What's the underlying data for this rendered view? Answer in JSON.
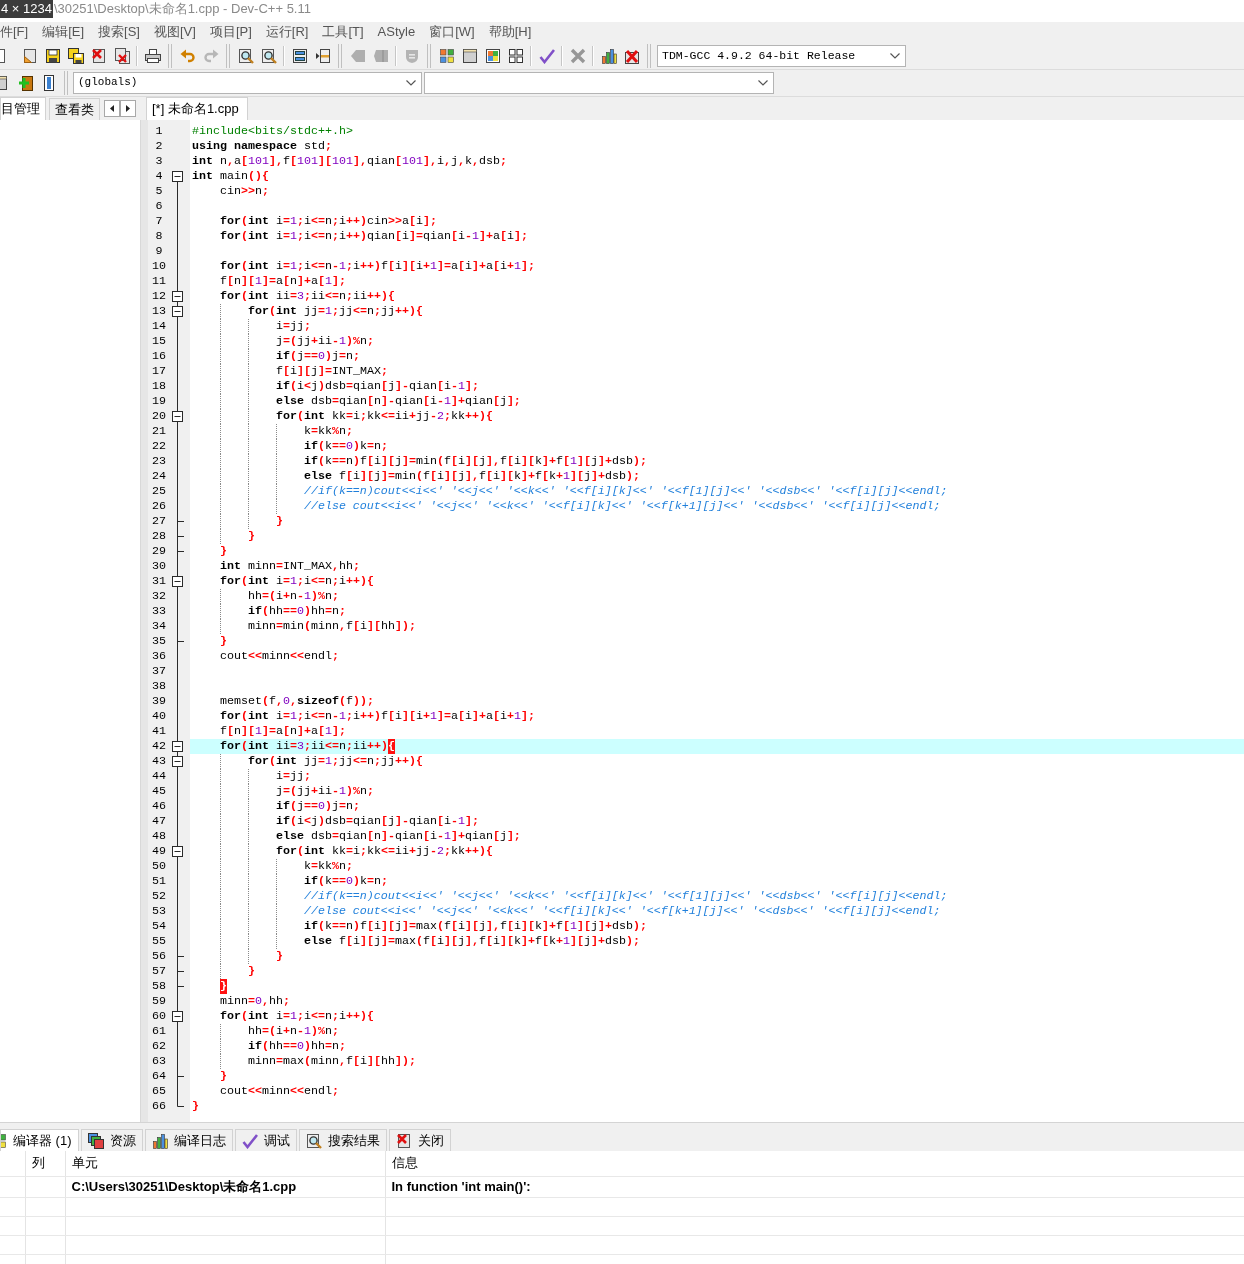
{
  "capture_overlay": "4 × 1234",
  "window": {
    "title": "\\30251\\Desktop\\未命名1.cpp - Dev-C++ 5.11"
  },
  "menu": [
    {
      "label": "件[F]"
    },
    {
      "label": "编辑[E]"
    },
    {
      "label": "搜索[S]"
    },
    {
      "label": "视图[V]"
    },
    {
      "label": "项目[P]"
    },
    {
      "label": "运行[R]"
    },
    {
      "label": "工具[T]"
    },
    {
      "label": "AStyle"
    },
    {
      "label": "窗口[W]"
    },
    {
      "label": "帮助[H]"
    }
  ],
  "toolbar_main": [
    {
      "disabled": false
    },
    {
      "disabled": false
    },
    {
      "disabled": false
    },
    {
      "disabled": false
    },
    {
      "disabled": false
    },
    {
      "disabled": false
    },
    {
      "disabled": false
    },
    {
      "disabled": false
    },
    {
      "disabled": true
    },
    {
      "disabled": false
    },
    {
      "disabled": false
    },
    {
      "disabled": false
    },
    {
      "disabled": false
    },
    {
      "disabled": true
    },
    {
      "disabled": true
    },
    {
      "disabled": true
    },
    {
      "disabled": false
    },
    {
      "disabled": false
    },
    {
      "disabled": false
    },
    {
      "disabled": false
    },
    {
      "disabled": false
    },
    {
      "disabled": true
    },
    {
      "disabled": false
    },
    {
      "disabled": false
    }
  ],
  "compiler_select": {
    "value": "TDM-GCC 4.9.2 64-bit Release"
  },
  "toolbar_secondary": [
    {
      "disabled": false
    },
    {
      "disabled": false
    },
    {
      "disabled": false
    }
  ],
  "class_select": {
    "value": "(globals)"
  },
  "left_panel": {
    "tabs": [
      {
        "label": "目管理",
        "selected": true
      },
      {
        "label": "查看类",
        "selected": false
      }
    ]
  },
  "editor": {
    "tabs": [
      {
        "label": "[*] 未命名1.cpp",
        "selected": true
      }
    ],
    "lines": [
      {
        "number": "1",
        "kind": "preprocessor",
        "text": "#include<bits/stdc++.h>",
        "current": false
      },
      {
        "number": "2",
        "kind": "code",
        "text": "**using namespace** std;",
        "current": false
      },
      {
        "number": "3",
        "kind": "code",
        "text": "**int** n,a[101],f[101][101],qian[101],i,j,k,dsb;",
        "current": false
      },
      {
        "number": "4",
        "kind": "code",
        "text": "**int** main(){",
        "expanded": true,
        "current": false
      },
      {
        "number": "5",
        "kind": "code",
        "text": "    cin>>n;",
        "current": false
      },
      {
        "number": "6",
        "current": false
      },
      {
        "number": "7",
        "kind": "code",
        "text": "    **for**(**int** i=1;i<=n;i++)cin>>a[i];",
        "current": false
      },
      {
        "number": "8",
        "kind": "code",
        "text": "    **for**(**int** i=1;i<=n;i++)qian[i]=qian[i-1]+a[i];",
        "current": false
      },
      {
        "number": "9",
        "current": false
      },
      {
        "number": "10",
        "kind": "code",
        "text": "    **for**(**int** i=1;i<=n-1;i++)f[i][i+1]=a[i]+a[i+1];",
        "current": false
      },
      {
        "number": "11",
        "kind": "code",
        "text": "    f[n][1]=a[n]+a[1];",
        "current": false
      },
      {
        "number": "12",
        "kind": "code",
        "text": "    **for**(**int** ii=3;ii<=n;ii++){",
        "expanded": true,
        "current": false
      },
      {
        "number": "13",
        "kind": "code",
        "text": "        **for**(**int** jj=1;jj<=n;jj++){",
        "expanded": true,
        "current": false
      },
      {
        "number": "14",
        "kind": "code",
        "text": "            i=jj;",
        "current": false
      },
      {
        "number": "15",
        "kind": "code",
        "text": "            j=(jj+ii-1)%n;",
        "current": false
      },
      {
        "number": "16",
        "kind": "code",
        "text": "            **if**(j==0)j=n;",
        "current": false
      },
      {
        "number": "17",
        "kind": "code",
        "text": "            f[i][j]=INT_MAX;",
        "current": false
      },
      {
        "number": "18",
        "kind": "code",
        "text": "            **if**(i<j)dsb=qian[j]-qian[i-1];",
        "current": false
      },
      {
        "number": "19",
        "kind": "code",
        "text": "            **else** dsb=qian[n]-qian[i-1]+qian[j];",
        "current": false
      },
      {
        "number": "20",
        "kind": "code",
        "text": "            **for**(**int** kk=i;kk<=ii+jj-2;kk++){",
        "expanded": true,
        "current": false
      },
      {
        "number": "21",
        "kind": "code",
        "text": "                k=kk%n;",
        "current": false
      },
      {
        "number": "22",
        "kind": "code",
        "text": "                **if**(k==0)k=n;",
        "current": false
      },
      {
        "number": "23",
        "kind": "code",
        "text": "                **if**(k==n)f[i][j]=min(f[i][j],f[i][k]+f[1][j]+dsb);",
        "current": false
      },
      {
        "number": "24",
        "kind": "code",
        "text": "                **else** f[i][j]=min(f[i][j],f[i][k]+f[k+1][j]+dsb);",
        "current": false
      },
      {
        "number": "25",
        "kind": "comment",
        "text": "                //if(k==n)cout<<i<<' '<<j<<' '<<k<<' '<<f[i][k]<<' '<<f[1][j]<<' '<<dsb<<' '<<f[i][j]<<endl;",
        "current": false
      },
      {
        "number": "26",
        "kind": "comment",
        "text": "                //else cout<<i<<' '<<j<<' '<<k<<' '<<f[i][k]<<' '<<f[k+1][j]<<' '<<dsb<<' '<<f[i][j]<<endl;",
        "current": false
      },
      {
        "number": "27",
        "kind": "code",
        "text": "            }",
        "fold_end": true,
        "current": false
      },
      {
        "number": "28",
        "kind": "code",
        "text": "        }",
        "fold_end": true,
        "current": false
      },
      {
        "number": "29",
        "kind": "code",
        "text": "    }",
        "fold_end": true,
        "current": false
      },
      {
        "number": "30",
        "kind": "code",
        "text": "    **int** minn=INT_MAX,hh;",
        "current": false
      },
      {
        "number": "31",
        "kind": "code",
        "text": "    **for**(**int** i=1;i<=n;i++){",
        "expanded": true,
        "current": false
      },
      {
        "number": "32",
        "kind": "code",
        "text": "        hh=(i+n-1)%n;",
        "current": false
      },
      {
        "number": "33",
        "kind": "code",
        "text": "        **if**(hh==0)hh=n;",
        "current": false
      },
      {
        "number": "34",
        "kind": "code",
        "text": "        minn=min(minn,f[i][hh]);",
        "current": false
      },
      {
        "number": "35",
        "kind": "code",
        "text": "    }",
        "fold_end": true,
        "current": false
      },
      {
        "number": "36",
        "kind": "code",
        "text": "    cout<<minn<<endl;",
        "current": false
      },
      {
        "number": "37",
        "current": false
      },
      {
        "number": "38",
        "current": false
      },
      {
        "number": "39",
        "kind": "code",
        "text": "    memset(f,0,**sizeof**(f));",
        "current": false
      },
      {
        "number": "40",
        "kind": "code",
        "text": "    **for**(**int** i=1;i<=n-1;i++)f[i][i+1]=a[i]+a[i+1];",
        "current": false
      },
      {
        "number": "41",
        "kind": "code",
        "text": "    f[n][1]=a[n]+a[1];",
        "current": false
      },
      {
        "number": "42",
        "kind": "code",
        "text": "    **for**(**int** ii=3;ii<=n;ii++)",
        "brace": "{",
        "expanded": true,
        "current": true
      },
      {
        "number": "43",
        "kind": "code",
        "text": "        **for**(**int** jj=1;jj<=n;jj++){",
        "expanded": true,
        "current": false
      },
      {
        "number": "44",
        "kind": "code",
        "text": "            i=jj;",
        "current": false
      },
      {
        "number": "45",
        "kind": "code",
        "text": "            j=(jj+ii-1)%n;",
        "current": false
      },
      {
        "number": "46",
        "kind": "code",
        "text": "            **if**(j==0)j=n;",
        "current": false
      },
      {
        "number": "47",
        "kind": "code",
        "text": "            **if**(i<j)dsb=qian[j]-qian[i-1];",
        "current": false
      },
      {
        "number": "48",
        "kind": "code",
        "text": "            **else** dsb=qian[n]-qian[i-1]+qian[j];",
        "current": false
      },
      {
        "number": "49",
        "kind": "code",
        "text": "            **for**(**int** kk=i;kk<=ii+jj-2;kk++){",
        "expanded": true,
        "current": false
      },
      {
        "number": "50",
        "kind": "code",
        "text": "                k=kk%n;",
        "current": false
      },
      {
        "number": "51",
        "kind": "code",
        "text": "                **if**(k==0)k=n;",
        "current": false
      },
      {
        "number": "52",
        "kind": "comment",
        "text": "                //if(k==n)cout<<i<<' '<<j<<' '<<k<<' '<<f[i][k]<<' '<<f[1][j]<<' '<<dsb<<' '<<f[i][j]<<endl;",
        "current": false
      },
      {
        "number": "53",
        "kind": "comment",
        "text": "                //else cout<<i<<' '<<j<<' '<<k<<' '<<f[i][k]<<' '<<f[k+1][j]<<' '<<dsb<<' '<<f[i][j]<<endl;",
        "current": false
      },
      {
        "number": "54",
        "kind": "code",
        "text": "                **if**(k==n)f[i][j]=max(f[i][j],f[i][k]+f[1][j]+dsb);",
        "current": false
      },
      {
        "number": "55",
        "kind": "code",
        "text": "                **else** f[i][j]=max(f[i][j],f[i][k]+f[k+1][j]+dsb);",
        "current": false
      },
      {
        "number": "56",
        "kind": "code",
        "text": "            }",
        "fold_end": true,
        "current": false
      },
      {
        "number": "57",
        "kind": "code",
        "text": "        }",
        "fold_end": true,
        "current": false
      },
      {
        "number": "58",
        "brace": "    }",
        "fold_end": true,
        "current": false
      },
      {
        "number": "59",
        "kind": "code",
        "text": "    minn=0,hh;",
        "current": false
      },
      {
        "number": "60",
        "kind": "code",
        "text": "    **for**(**int** i=1;i<=n;i++){",
        "expanded": true,
        "current": false
      },
      {
        "number": "61",
        "kind": "code",
        "text": "        hh=(i+n-1)%n;",
        "current": false
      },
      {
        "number": "62",
        "kind": "code",
        "text": "        **if**(hh==0)hh=n;",
        "current": false
      },
      {
        "number": "63",
        "kind": "code",
        "text": "        minn=max(minn,f[i][hh]);",
        "current": false
      },
      {
        "number": "64",
        "kind": "code",
        "text": "    }",
        "fold_end": true,
        "current": false
      },
      {
        "number": "65",
        "kind": "code",
        "text": "    cout<<minn<<endl;",
        "current": false
      },
      {
        "number": "66",
        "kind": "code",
        "text": "}",
        "fold_end": true,
        "current": false
      }
    ]
  },
  "bottom_panel": {
    "tabs": [
      {
        "label": "编译器 (1)",
        "selected": true
      },
      {
        "label": "资源",
        "selected": false
      },
      {
        "label": "编译日志",
        "selected": false
      },
      {
        "label": "调试",
        "selected": false
      },
      {
        "label": "搜索结果",
        "selected": false
      },
      {
        "label": "关闭",
        "selected": false
      }
    ],
    "table": {
      "columns": [
        "列",
        "单元",
        "信息"
      ],
      "rows": [
        {
          "unit": "C:\\Users\\30251\\Desktop\\未命名1.cpp",
          "message": "In function 'int main()':"
        }
      ]
    }
  }
}
